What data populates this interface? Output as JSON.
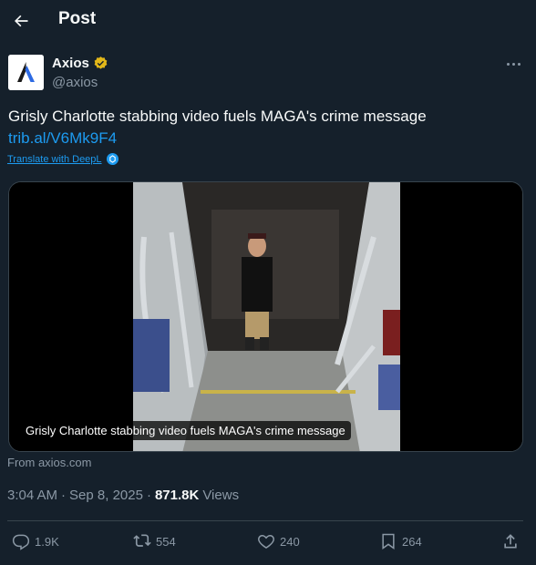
{
  "header": {
    "title": "Post"
  },
  "author": {
    "name": "Axios",
    "handle": "@axios"
  },
  "tweet": {
    "text": "Grisly Charlotte stabbing video fuels MAGA's crime message",
    "link": "trib.al/V6Mk9F4",
    "translate_label": "Translate with DeepL"
  },
  "card": {
    "caption": "Grisly Charlotte stabbing video fuels MAGA's crime message",
    "source": "From axios.com"
  },
  "meta": {
    "time": "3:04 AM",
    "date": "Sep 8, 2025",
    "separator": "·",
    "views_count": "871.8K",
    "views_label": "Views"
  },
  "actions": {
    "replies": "1.9K",
    "reposts": "554",
    "likes": "240",
    "bookmarks": "264"
  },
  "colors": {
    "background": "#15202b",
    "accent": "#1d9bf0",
    "muted": "#8b98a5",
    "verified_gold": "#e2b719"
  }
}
